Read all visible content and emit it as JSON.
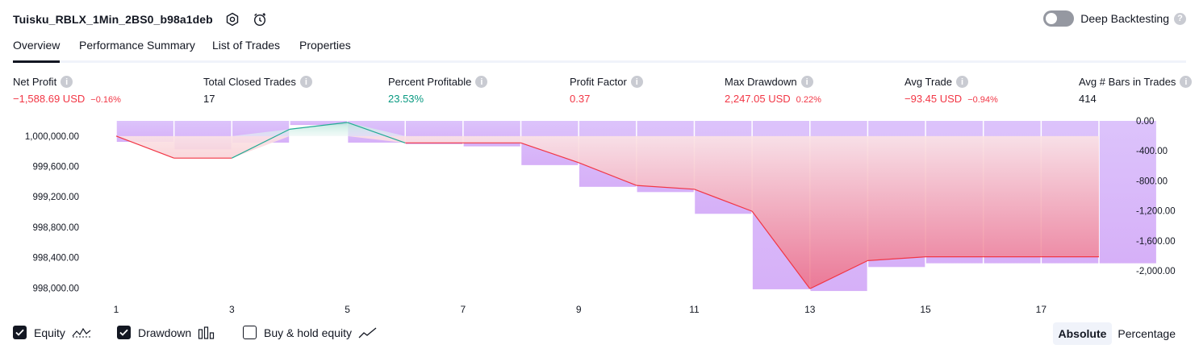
{
  "header": {
    "strategy_name": "Tuisku_RBLX_1Min_2BS0_b98a1deb",
    "deep_backtesting_label": "Deep Backtesting",
    "deep_backtesting_on": false
  },
  "tabs": [
    {
      "label": "Overview",
      "active": true
    },
    {
      "label": "Performance Summary",
      "active": false
    },
    {
      "label": "List of Trades",
      "active": false
    },
    {
      "label": "Properties",
      "active": false
    }
  ],
  "metrics": [
    {
      "label": "Net Profit",
      "value": "−1,588.69 USD",
      "pct": "−0.16%",
      "tone": "neg"
    },
    {
      "label": "Total Closed Trades",
      "value": "17",
      "pct": "",
      "tone": "neutral"
    },
    {
      "label": "Percent Profitable",
      "value": "23.53%",
      "pct": "",
      "tone": "pos"
    },
    {
      "label": "Profit Factor",
      "value": "0.37",
      "pct": "",
      "tone": "neg"
    },
    {
      "label": "Max Drawdown",
      "value": "2,247.05 USD",
      "pct": "0.22%",
      "tone": "neg"
    },
    {
      "label": "Avg Trade",
      "value": "−93.45 USD",
      "pct": "−0.94%",
      "tone": "neg"
    },
    {
      "label": "Avg # Bars in Trades",
      "value": "414",
      "pct": "",
      "tone": "neutral"
    }
  ],
  "chart_data": {
    "type": "line",
    "x": [
      1,
      2,
      3,
      4,
      5,
      6,
      7,
      8,
      9,
      10,
      11,
      12,
      13,
      14,
      15,
      16,
      17,
      18
    ],
    "x_tick_labels": [
      "1",
      "3",
      "5",
      "7",
      "9",
      "11",
      "13",
      "15",
      "17"
    ],
    "series": [
      {
        "values": [
          1000000.0,
          999710.0,
          999710.0,
          1000090.0,
          1000180.0,
          999910.0,
          999910.0,
          999910.0,
          999650.0,
          999350.0,
          999300.0,
          999010.0,
          997990.0,
          998360.0,
          998410.0,
          998410.0,
          998410.0,
          998410.0
        ]
      },
      {
        "values": [
          -280.0,
          -380.0,
          -290.0,
          -55.0,
          -290.0,
          -310.0,
          -340.0,
          -590.0,
          -880.0,
          -950.0,
          -1240.0,
          -2247.05,
          -2270.0,
          -1950.0,
          -1900.0,
          -1900.0,
          -1900.0,
          -1900.0
        ]
      }
    ],
    "left_axis": {
      "ticks": [
        "1,000,000.00",
        "999,600.00",
        "999,200.00",
        "998,800.00",
        "998,400.00",
        "998,000.00"
      ],
      "tick_values": [
        1000000,
        999600,
        999200,
        998800,
        998400,
        998000
      ],
      "ylim": [
        997950,
        1000200
      ]
    },
    "right_axis": {
      "ticks": [
        "0.00",
        "-400.00",
        "-800.00",
        "-1,200.00",
        "-1,600.00",
        "-2,000.00"
      ],
      "tick_values": [
        0,
        -400,
        -800,
        -1200,
        -1600,
        -2000
      ],
      "ylim": [
        -2280,
        0
      ]
    },
    "colors": {
      "equity_loss": "#f23645",
      "equity_gain": "#22ab94",
      "drawdown": "#c8a2fa"
    }
  },
  "legend": [
    {
      "label": "Equity",
      "checked": true,
      "icon": "equity-line-icon"
    },
    {
      "label": "Drawdown",
      "checked": true,
      "icon": "drawdown-bars-icon"
    },
    {
      "label": "Buy & hold equity",
      "checked": false,
      "icon": "buy-hold-line-icon"
    }
  ],
  "scale_toggle": {
    "options": [
      "Absolute",
      "Percentage"
    ],
    "selected": "Absolute"
  }
}
